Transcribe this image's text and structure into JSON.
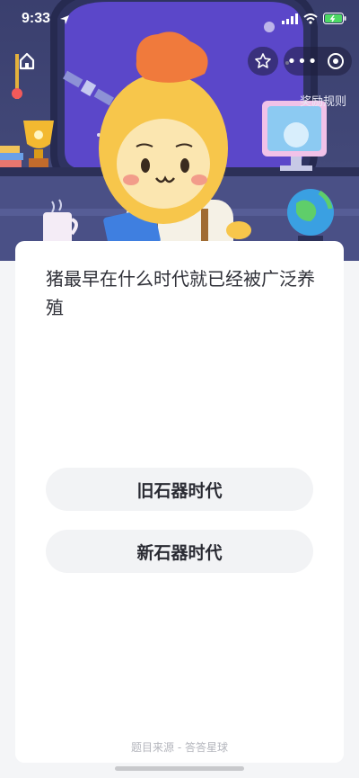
{
  "status_bar": {
    "time": "9:33"
  },
  "header": {
    "reward_rules_label": "奖励规则"
  },
  "question": {
    "text": "猪最早在什么时代就已经被广泛养殖"
  },
  "options": [
    {
      "label": "旧石器时代"
    },
    {
      "label": "新石器时代"
    }
  ],
  "footer": {
    "source_text": "题目来源 - 答答星球"
  },
  "colors": {
    "scene_bg": "#3a3f6e",
    "card_bg": "#ffffff",
    "option_bg": "#f2f3f5",
    "mascot_yellow": "#f7c64b",
    "hat_orange": "#f07a3c"
  },
  "icons": [
    "location-arrow-icon",
    "signal-icon",
    "wifi-icon",
    "battery-icon",
    "home-icon",
    "star-icon",
    "more-icon",
    "close-icon",
    "trophy-icon",
    "mug-icon",
    "globe-icon",
    "satellite-icon"
  ]
}
